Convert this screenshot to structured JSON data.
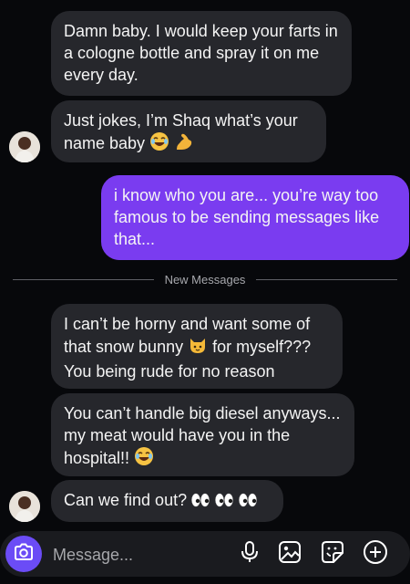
{
  "messages": {
    "m1": "Damn baby. I would keep your farts in a cologne bottle and spray it on me every day.",
    "m2": "Just jokes, I’m Shaq what’s your name baby",
    "m3": "i know who you are... you’re way too famous to be sending messages like that...",
    "m4a": "I can’t be horny and want some of that snow bunny",
    "m4b": "for myself??? You being rude for no reason",
    "m5": "You can’t handle big diesel anyways... my meat would have you in the hospital!!",
    "m6": "Can we find out?"
  },
  "divider": {
    "label": "New Messages"
  },
  "composer": {
    "placeholder": "Message..."
  },
  "icons": [
    "camera-icon",
    "microphone-icon",
    "gallery-icon",
    "sticker-icon",
    "add-icon",
    "laughing-emoji",
    "flexed-biceps-emoji",
    "cat-emoji",
    "eyes-emoji"
  ],
  "colors": {
    "background": "#07080b",
    "incoming": "#26272c",
    "outgoing": "#7a3cf0",
    "camera": "#6b4cf6"
  }
}
